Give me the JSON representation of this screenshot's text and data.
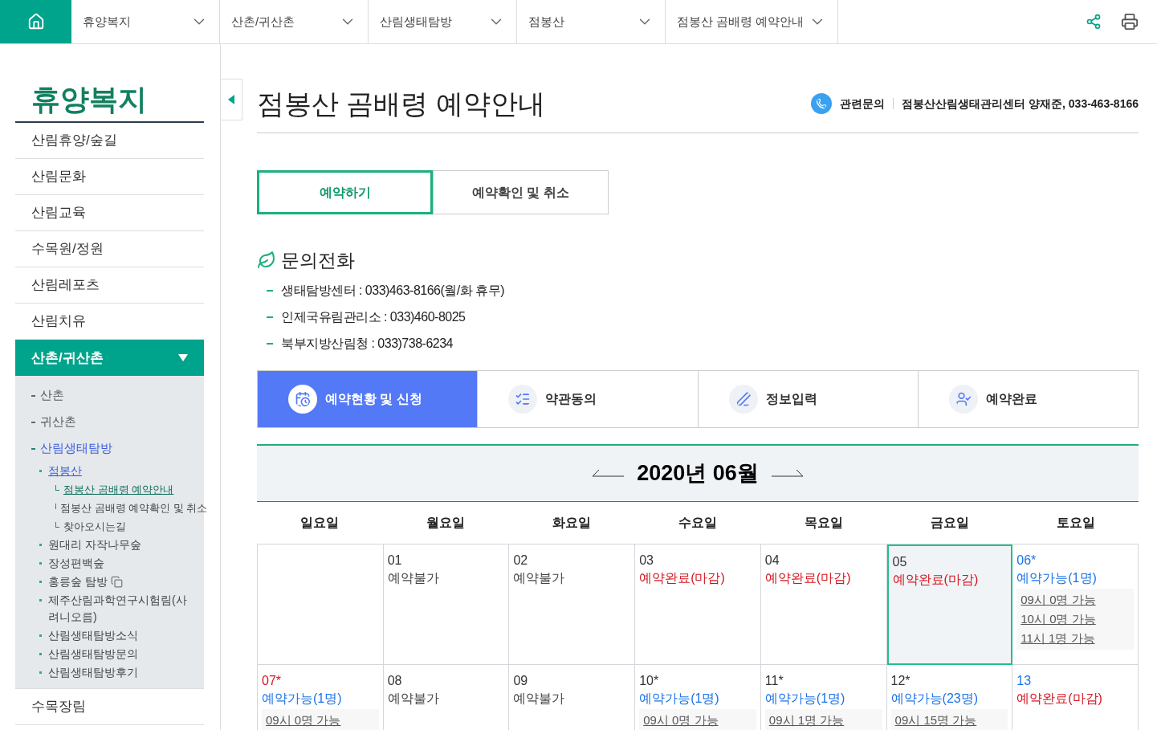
{
  "top_nav": {
    "items": [
      {
        "label": "휴양복지"
      },
      {
        "label": "산촌/귀산촌"
      },
      {
        "label": "산림생태탐방"
      },
      {
        "label": "점봉산"
      },
      {
        "label": "점봉산 곰배령 예약안내"
      }
    ]
  },
  "sidebar": {
    "title": "휴양복지",
    "items": [
      {
        "label": "산림휴양/숲길",
        "selected": false
      },
      {
        "label": "산림문화",
        "selected": false
      },
      {
        "label": "산림교육",
        "selected": false
      },
      {
        "label": "수목원/정원",
        "selected": false
      },
      {
        "label": "산림레포츠",
        "selected": false
      },
      {
        "label": "산림치유",
        "selected": false
      },
      {
        "label": "산촌/귀산촌",
        "selected": true,
        "expanded": true,
        "children": [
          {
            "label": "산촌",
            "selected": false
          },
          {
            "label": "귀산촌",
            "selected": false
          },
          {
            "label": "산림생태탐방",
            "selected": true,
            "children": [
              {
                "label": "점봉산",
                "selected": true,
                "external": false,
                "children": [
                  {
                    "label": "점봉산 곰배령 예약안내",
                    "selected": true
                  },
                  {
                    "label": "점봉산 곰배령 예약확인 및 취소",
                    "selected": false
                  },
                  {
                    "label": "찾아오시는길",
                    "selected": false
                  }
                ]
              },
              {
                "label": "원대리 자작나무숲",
                "selected": false,
                "external": false
              },
              {
                "label": "장성편백숲",
                "selected": false,
                "external": false
              },
              {
                "label": "홍릉숲 탐방",
                "selected": false,
                "external": true
              },
              {
                "label": "제주산림과학연구시험림(사려니오름)",
                "selected": false,
                "external": false
              },
              {
                "label": "산림생태탐방소식",
                "selected": false,
                "external": false
              },
              {
                "label": "산림생태탐방문의",
                "selected": false,
                "external": false
              },
              {
                "label": "산림생태탐방후기",
                "selected": false,
                "external": false
              }
            ]
          }
        ]
      },
      {
        "label": "수목장림",
        "selected": false
      }
    ]
  },
  "page": {
    "title": "점봉산 곰배령 예약안내",
    "contact_label": "관련문의",
    "contact_text": "점봉산산림생태관리센터 양재준, 033-463-8166"
  },
  "tabs": [
    {
      "label": "예약하기",
      "selected": true
    },
    {
      "label": "예약확인 및 취소",
      "selected": false
    }
  ],
  "inquiry": {
    "heading": "문의전화",
    "lines": [
      "생태탐방센터 : 033)463-8166(월/화 휴무)",
      "인제국유림관리소 : 033)460-8025",
      "북부지방산림청 : 033)738-6234"
    ]
  },
  "steps": [
    {
      "kind": "calendar",
      "label": "예약현황 및 신청",
      "selected": true
    },
    {
      "kind": "checklist",
      "label": "약관동의",
      "selected": false
    },
    {
      "kind": "pen",
      "label": "정보입력",
      "selected": false
    },
    {
      "kind": "person",
      "label": "예약완료",
      "selected": false
    }
  ],
  "calendar": {
    "month": "2020년 06월",
    "weekdays": [
      "일요일",
      "월요일",
      "화요일",
      "수요일",
      "목요일",
      "금요일",
      "토요일"
    ],
    "weeks": [
      [
        {
          "kind": "empty"
        },
        {
          "kind": "day",
          "day": "01",
          "status": "예약불가",
          "color": "#444444",
          "selected": false
        },
        {
          "kind": "day",
          "day": "02",
          "status": "예약불가",
          "color": "#444444",
          "selected": false
        },
        {
          "kind": "day",
          "day": "03",
          "status": "예약완료(마감)",
          "color": "#d2141e",
          "selected": false
        },
        {
          "kind": "day",
          "day": "04",
          "status": "예약완료(마감)",
          "color": "#d2141e",
          "selected": false
        },
        {
          "kind": "day",
          "day": "05",
          "status": "예약완료(마감)",
          "color": "#d2141e",
          "selected": true
        },
        {
          "kind": "day",
          "day": "06*",
          "status": "예약가능(1명)",
          "color": "#1a73e8",
          "selected": false,
          "slots": [
            "09시 0명 가능",
            "10시 0명 가능",
            "11시 1명 가능"
          ]
        }
      ],
      [
        {
          "kind": "day",
          "day": "07*",
          "status": "예약가능(1명)",
          "color": "#1a73e8",
          "selected": false,
          "slots": [
            "09시 0명 가능"
          ]
        },
        {
          "kind": "day",
          "day": "08",
          "status": "예약불가",
          "color": "#444444",
          "selected": false
        },
        {
          "kind": "day",
          "day": "09",
          "status": "예약불가",
          "color": "#444444",
          "selected": false
        },
        {
          "kind": "day",
          "day": "10*",
          "status": "예약가능(1명)",
          "color": "#1a73e8",
          "selected": false,
          "slots": [
            "09시 0명 가능"
          ]
        },
        {
          "kind": "day",
          "day": "11*",
          "status": "예약가능(1명)",
          "color": "#1a73e8",
          "selected": false,
          "slots": [
            "09시 1명 가능"
          ]
        },
        {
          "kind": "day",
          "day": "12*",
          "status": "예약가능(23명)",
          "color": "#1a73e8",
          "selected": false,
          "slots": [
            "09시 15명 가능"
          ]
        },
        {
          "kind": "day",
          "day": "13",
          "status": "예약완료(마감)",
          "color": "#d2141e",
          "selected": false
        }
      ]
    ]
  }
}
